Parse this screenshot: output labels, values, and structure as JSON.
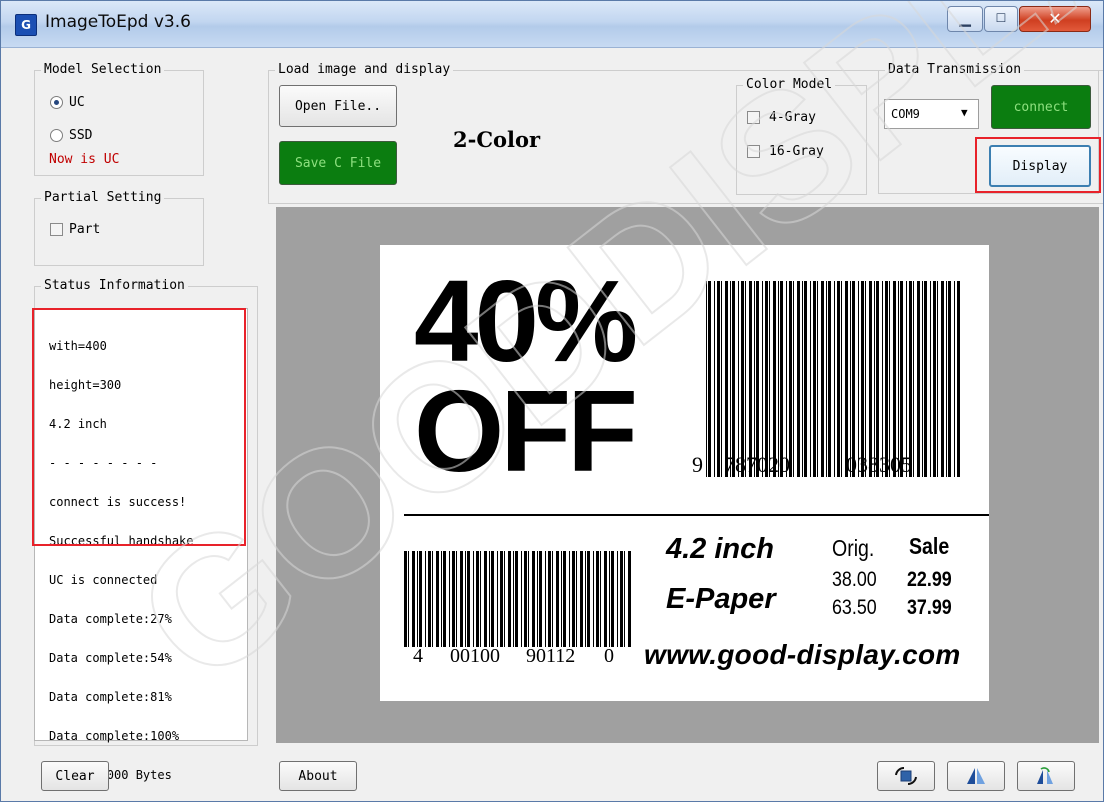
{
  "window": {
    "title": "ImageToEpd v3.6",
    "icon_text": "G"
  },
  "model_selection": {
    "legend": "Model Selection",
    "options": [
      {
        "label": "UC",
        "selected": true
      },
      {
        "label": "SSD",
        "selected": false
      }
    ],
    "status": "Now is UC",
    "status_color": "#c00000"
  },
  "partial_setting": {
    "legend": "Partial Setting",
    "part_label": "Part"
  },
  "status_info": {
    "legend": "Status Information",
    "lines": [
      "with=400",
      "height=300",
      "4.2 inch",
      "- - - - - - - -",
      "connect is success!",
      "Successful handshake",
      "UC is connected",
      "Data complete:27%",
      "Data complete:54%",
      "Data complete:81%",
      "Data complete:100%",
      "Datas=15000 Bytes"
    ]
  },
  "load_image": {
    "legend": "Load image and display",
    "open_label": "Open File..",
    "save_label": "Save C File",
    "mode_label": "2-Color"
  },
  "color_model": {
    "legend": "Color Model",
    "gray4_label": "4-Gray",
    "gray16_label": "16-Gray"
  },
  "data_transmission": {
    "legend": "Data Transmission",
    "port": "COM9",
    "connect_label": "connect",
    "display_label": "Display"
  },
  "bottom": {
    "clear_label": "Clear",
    "about_label": "About"
  },
  "icons": [
    "rotate-icon",
    "flip-icon",
    "mirror-icon"
  ],
  "colors": {
    "accent_green": "#0b7d10",
    "highlight_red": "#e8222a",
    "preview_bg": "#a0a0a0"
  },
  "preview": {
    "discount": "40%",
    "off": "OFF",
    "barcode1_digits": [
      "9",
      "787020",
      "038305"
    ],
    "barcode2_digits": [
      "4",
      "00100",
      "90112",
      "0"
    ],
    "size_text": "4.2 inch",
    "product_text": "E-Paper",
    "orig_header": "Orig.",
    "sale_header": "Sale",
    "orig_prices": [
      "38.00",
      "63.50"
    ],
    "sale_prices": [
      "22.99",
      "37.99"
    ],
    "website": "www.good-display.com"
  },
  "watermark": "GOODDISPLAY"
}
